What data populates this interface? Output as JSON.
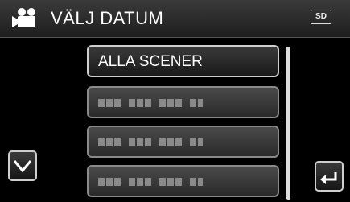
{
  "header": {
    "icon": "video-camera-icon",
    "title": "VÄLJ DATUM",
    "media_badge": "SD"
  },
  "list": {
    "items": [
      {
        "label": "ALLA SCENER",
        "selected": true
      },
      {
        "label": "",
        "placeholder": true
      },
      {
        "label": "",
        "placeholder": true
      },
      {
        "label": "",
        "placeholder": true
      }
    ]
  },
  "controls": {
    "scroll_down_icon": "chevron-down-icon",
    "back_icon": "return-arrow-icon"
  },
  "colors": {
    "background": "#000000",
    "text": "#ffffff",
    "button_border": "#8a8a8a"
  }
}
